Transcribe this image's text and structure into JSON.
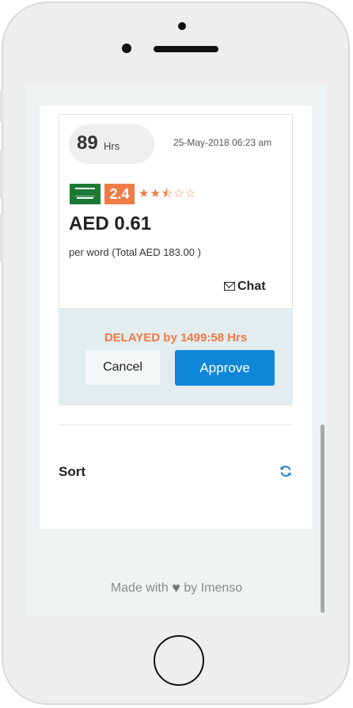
{
  "card": {
    "hours_value": "89",
    "hours_unit": "Hrs",
    "timestamp": "25-May-2018 06:23 am",
    "rating": "2.4",
    "rating_stars_filled": 2.5,
    "rating_stars_total": 5,
    "price": "AED 0.61",
    "price_note": "per word (Total AED 183.00 )",
    "chat_label": "Chat"
  },
  "actions": {
    "delayed_text": "DELAYED by 1499:58 Hrs",
    "cancel_label": "Cancel",
    "approve_label": "Approve"
  },
  "sort": {
    "label": "Sort"
  },
  "footer": {
    "made_with": "Made with",
    "by_text": "by Imenso"
  },
  "icons": {
    "flag": "saudi-arabia-flag-icon",
    "stars": "star-rating-icon",
    "chat": "envelope-icon",
    "refresh": "refresh-icon",
    "heart": "heart-icon"
  },
  "colors": {
    "accent_orange": "#ef7b45",
    "primary_blue": "#0f87d8",
    "action_bg": "#e3ecee",
    "flag_green": "#1a7a34"
  }
}
